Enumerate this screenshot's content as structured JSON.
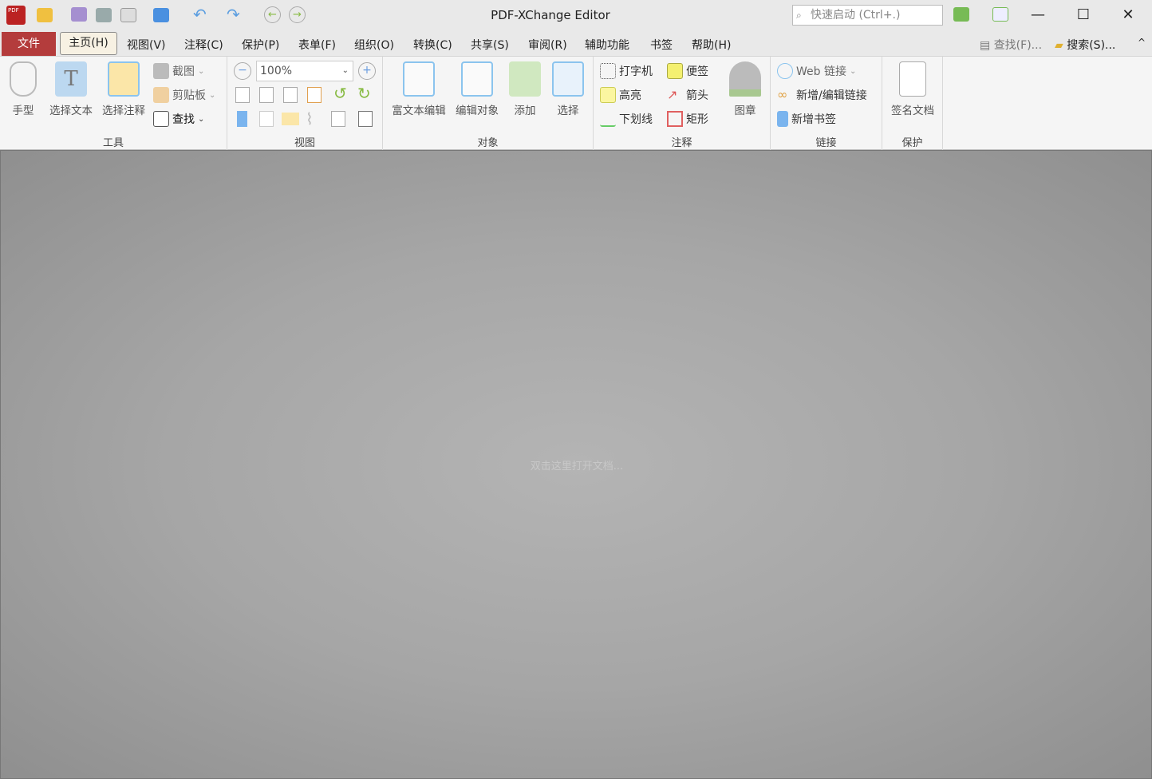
{
  "title": "PDF-XChange Editor",
  "quick_launch": {
    "placeholder": "快速启动 (Ctrl+.)"
  },
  "menu": {
    "file": "文件",
    "tabs": [
      "主页(H)",
      "视图(V)",
      "注释(C)",
      "保护(P)",
      "表单(F)",
      "组织(O)",
      "转换(C)",
      "共享(S)",
      "审阅(R)",
      "辅助功能",
      "书签",
      "帮助(H)"
    ],
    "find": "查找(F)...",
    "search": "搜索(S)..."
  },
  "ribbon": {
    "tools": {
      "label": "工具",
      "hand": "手型",
      "select_text": "选择文本",
      "select_annot": "选择注释",
      "snapshot": "截图",
      "clipboard": "剪贴板",
      "find": "查找"
    },
    "view": {
      "label": "视图",
      "zoom": "100%"
    },
    "objects": {
      "label": "对象",
      "rich_text": "富文本编辑",
      "edit_obj": "编辑对象",
      "add": "添加",
      "select": "选择"
    },
    "comment": {
      "label": "注释",
      "typewriter": "打字机",
      "note": "便签",
      "highlight": "高亮",
      "arrow": "箭头",
      "underline": "下划线",
      "rect": "矩形",
      "stamp": "图章"
    },
    "links": {
      "label": "链接",
      "web": "Web 链接",
      "add_link": "新增/编辑链接",
      "add_bookmark": "新增书签"
    },
    "protect": {
      "label": "保护",
      "sign": "签名文档"
    }
  },
  "doc": {
    "hint": "双击这里打开文档..."
  },
  "window": {
    "minimize": "—",
    "maximize": "☐",
    "close": "✕"
  }
}
